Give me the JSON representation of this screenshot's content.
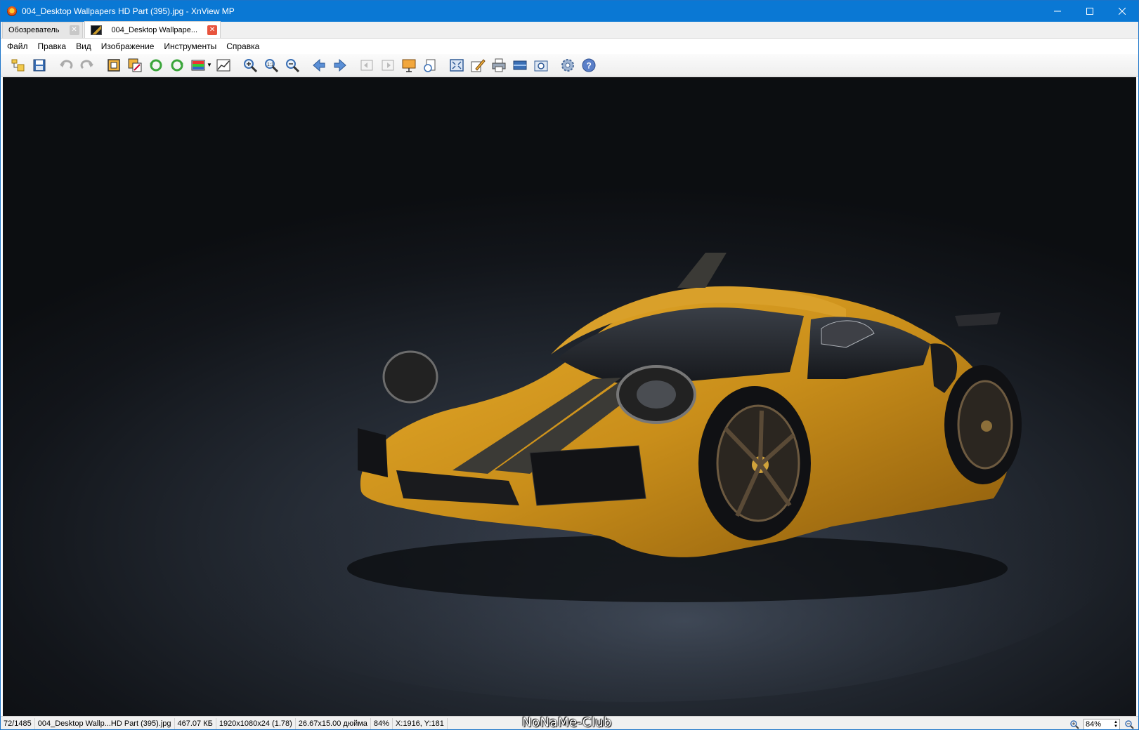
{
  "window": {
    "title": "004_Desktop Wallpapers  HD Part (395).jpg - XnView MP"
  },
  "tabs": [
    {
      "label": "Обозреватель"
    },
    {
      "label": "004_Desktop Wallpape..."
    }
  ],
  "menu": {
    "items": [
      "Файл",
      "Правка",
      "Вид",
      "Изображение",
      "Инструменты",
      "Справка"
    ]
  },
  "toolbar": {
    "icons": [
      "browse-icon",
      "save-icon",
      "undo-icon",
      "redo-icon",
      "crop-icon",
      "resize-icon",
      "rotate-left-icon",
      "rotate-right-icon",
      "adjust-colors-icon",
      "levels-icon",
      "zoom-in-icon",
      "zoom-actual-icon",
      "zoom-out-icon",
      "prev-icon",
      "next-icon",
      "first-icon",
      "last-icon",
      "slideshow-icon",
      "info-icon",
      "fit-icon",
      "edit-icon",
      "print-icon",
      "scan-icon",
      "capture-icon",
      "settings-icon",
      "help-icon"
    ]
  },
  "status": {
    "position": "72/1485",
    "filename": "004_Desktop Wallp...HD Part (395).jpg",
    "filesize": "467.07 КБ",
    "dimensions": "1920x1080x24 (1.78)",
    "print_size": "26.67x15.00 дюйма",
    "zoom": "84%",
    "coords": "X:1916, Y:181",
    "zoom_field": "84%",
    "watermark": "NoNaMe-Club"
  },
  "colors": {
    "titlebar": "#0a78d4",
    "car_body": "#d69a1e",
    "background": "#1b2027"
  }
}
